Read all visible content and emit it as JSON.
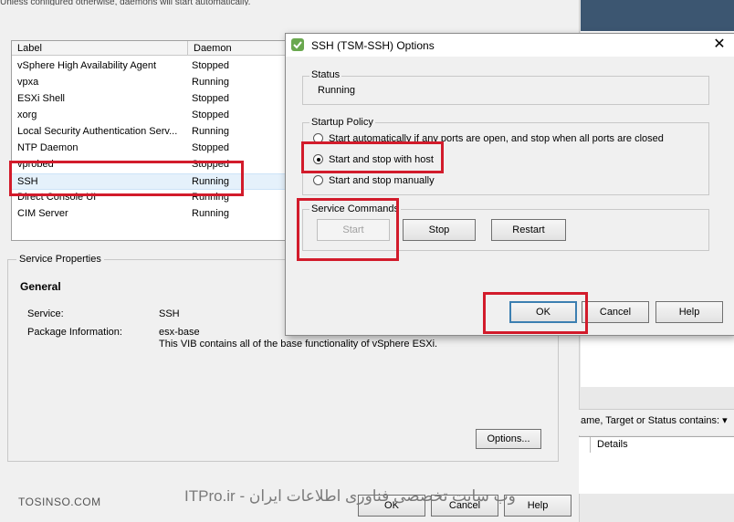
{
  "background": {
    "top_text": "Unless configured otherwise, daemons will start automatically.",
    "table": {
      "headers": [
        "Label",
        "Daemon"
      ],
      "rows": [
        {
          "label": "vSphere High Availability Agent",
          "daemon": "Stopped"
        },
        {
          "label": "vpxa",
          "daemon": "Running"
        },
        {
          "label": "ESXi Shell",
          "daemon": "Stopped"
        },
        {
          "label": "xorg",
          "daemon": "Stopped"
        },
        {
          "label": "Local Security Authentication Serv...",
          "daemon": "Running"
        },
        {
          "label": "NTP Daemon",
          "daemon": "Stopped"
        },
        {
          "label": "vprobed",
          "daemon": "Stopped"
        },
        {
          "label": "SSH",
          "daemon": "Running"
        },
        {
          "label": "Direct Console UI",
          "daemon": "Running"
        },
        {
          "label": "CIM Server",
          "daemon": "Running"
        }
      ]
    },
    "service_properties": {
      "title": "Service Properties",
      "general_heading": "General",
      "service_label": "Service:",
      "service_value": "SSH",
      "package_label": "Package Information:",
      "package_value": "esx-base",
      "package_desc": "This VIB contains all of the base functionality of vSphere ESXi.",
      "options_button": "Options..."
    },
    "footer_buttons": {
      "ok": "OK",
      "cancel": "Cancel",
      "help": "Help"
    },
    "right_panel": {
      "filter_text": "ame, Target or Status contains: ▾",
      "details_header": "Details"
    }
  },
  "dialog": {
    "title": "SSH (TSM-SSH) Options",
    "close_glyph": "✕",
    "status_group": {
      "title": "Status",
      "value": "Running"
    },
    "startup_policy": {
      "title": "Startup Policy",
      "options": [
        "Start automatically if any ports are open, and stop when all ports are closed",
        "Start and stop with host",
        "Start and stop manually"
      ],
      "selected_index": 1
    },
    "service_commands": {
      "title": "Service Commands",
      "start": "Start",
      "stop": "Stop",
      "restart": "Restart"
    },
    "buttons": {
      "ok": "OK",
      "cancel": "Cancel",
      "help": "Help"
    }
  },
  "watermark": {
    "brand": "TOSINSO.COM",
    "persian": "ITPro.ir - وب سایت تخصصی فناوری اطلاعات ایران"
  },
  "colors": {
    "highlight": "#d21b2b",
    "selection": "#e5f1fb",
    "header_blue": "#3c5671",
    "default_button_border": "#3c7fb1"
  },
  "icons": [
    "vmware-icon",
    "close-icon",
    "radio-icon",
    "dropdown-chevron-icon"
  ]
}
